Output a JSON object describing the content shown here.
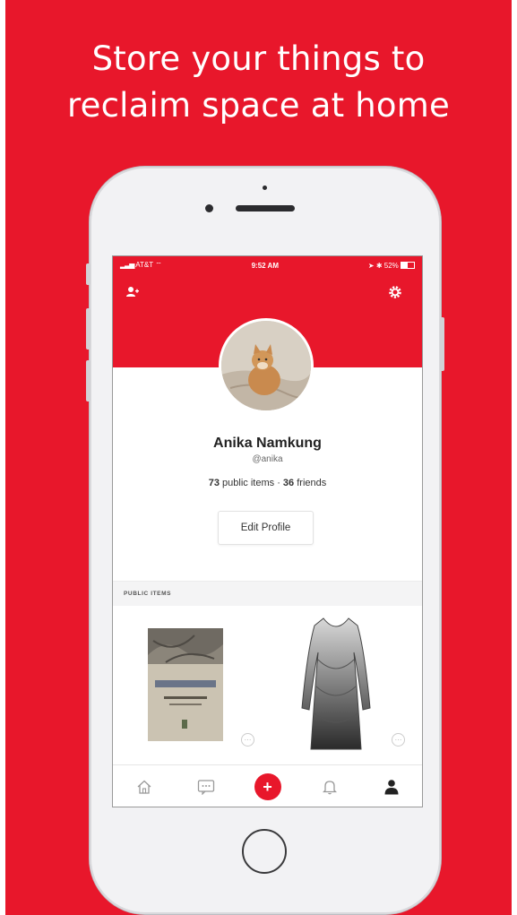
{
  "promo": {
    "headline_line1": "Store your things to",
    "headline_line2": "reclaim space at home",
    "background_color": "#e8172b"
  },
  "status_bar": {
    "carrier": "AT&T",
    "time": "9:52 AM",
    "battery": "52%"
  },
  "header": {
    "left_icon": "add-friend-icon",
    "right_icon": "gear-icon"
  },
  "profile": {
    "name": "Anika Namkung",
    "handle": "@anika",
    "public_items_count": "73",
    "public_items_label": "public items",
    "separator": "·",
    "friends_count": "36",
    "friends_label": "friends",
    "edit_button_label": "Edit Profile"
  },
  "public_items": {
    "section_title": "PUBLIC ITEMS",
    "items": [
      {
        "name": "book",
        "more_icon": "more-icon"
      },
      {
        "name": "dress",
        "more_icon": "more-icon"
      }
    ]
  },
  "tabbar": {
    "tabs": [
      "home-icon",
      "messages-icon",
      "add-icon",
      "bell-icon",
      "profile-icon"
    ],
    "add_label": "+",
    "active_tab": "profile-icon"
  }
}
